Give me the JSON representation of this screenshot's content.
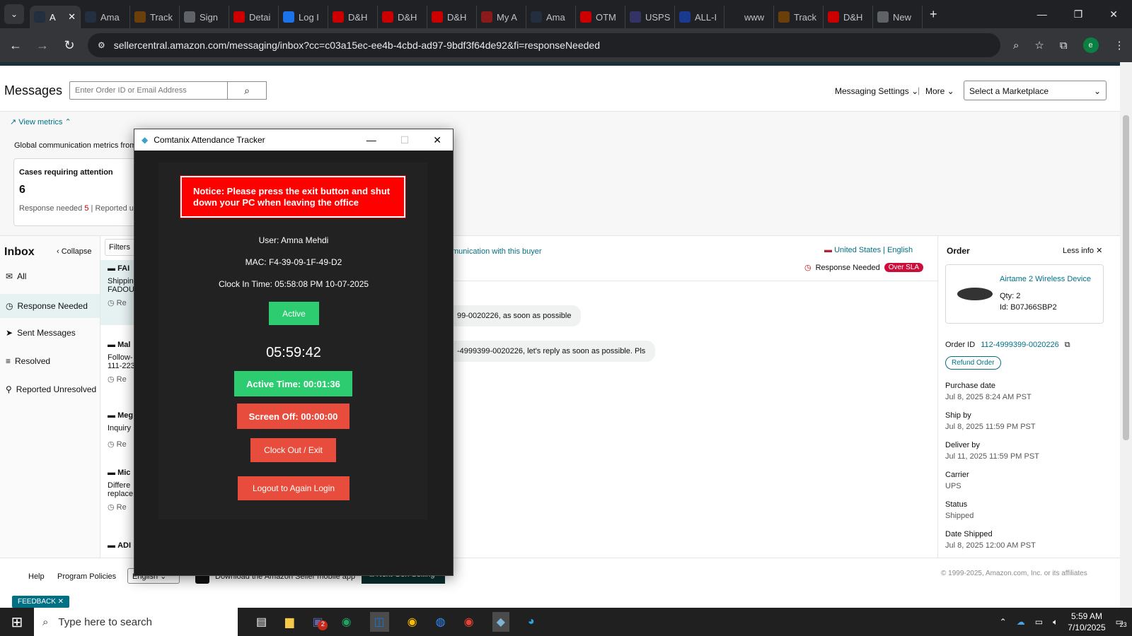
{
  "browser": {
    "tabs": [
      {
        "label": "A",
        "icon": "amazon-icon",
        "color": "#232f3e"
      },
      {
        "label": "Ama",
        "icon": "amazon-icon",
        "color": "#232f3e"
      },
      {
        "label": "Track",
        "icon": "ups-icon",
        "color": "#6b3f0c"
      },
      {
        "label": "Sign",
        "icon": "globe-icon",
        "color": "#5f6368"
      },
      {
        "label": "Detai",
        "icon": "dh-icon",
        "color": "#c00"
      },
      {
        "label": "Log I",
        "icon": "google-icon",
        "color": "#1a73e8"
      },
      {
        "label": "D&H",
        "icon": "dh-icon",
        "color": "#c00"
      },
      {
        "label": "D&H",
        "icon": "dh-icon",
        "color": "#c00"
      },
      {
        "label": "D&H",
        "icon": "dh-icon",
        "color": "#c00"
      },
      {
        "label": "My A",
        "icon": "my-icon",
        "color": "#8b1a1a"
      },
      {
        "label": "Ama",
        "icon": "amazon-icon",
        "color": "#232f3e"
      },
      {
        "label": "OTM",
        "icon": "otm-icon",
        "color": "#c00"
      },
      {
        "label": "USPS",
        "icon": "usps-icon",
        "color": "#333366"
      },
      {
        "label": "ALL-I",
        "icon": "17track-icon",
        "color": "#1a3a8f"
      },
      {
        "label": "www",
        "icon": "dot-icon",
        "color": "#202124"
      },
      {
        "label": "Track",
        "icon": "ups-icon",
        "color": "#6b3f0c"
      },
      {
        "label": "D&H",
        "icon": "dh-icon",
        "color": "#c00"
      },
      {
        "label": "New",
        "icon": "chrome-icon",
        "color": "#5f6368"
      }
    ],
    "url": "sellercentral.amazon.com/messaging/inbox?cc=c03a15ec-ee4b-4cbd-ad97-9bdf3f64de92&fi=responseNeeded",
    "profile_initial": "e"
  },
  "header": {
    "title": "Messages",
    "search_placeholder": "Enter Order ID or Email Address",
    "messaging_settings": "Messaging Settings",
    "more": "More",
    "marketplace_placeholder": "Select a Marketplace"
  },
  "metrics": {
    "view_metrics": "View metrics",
    "global_text": "Global communication metrics from a",
    "cases_title": "Cases requiring attention",
    "cases_count": "6",
    "response_needed_label": "Response needed",
    "response_needed_count": "5",
    "reported_label": "Reported u"
  },
  "inbox": {
    "title": "Inbox",
    "collapse": "Collapse",
    "filters": "Filters",
    "items": [
      {
        "label": "All",
        "icon": "mail-icon"
      },
      {
        "label": "Response Needed",
        "icon": "clock-icon"
      },
      {
        "label": "Sent Messages",
        "icon": "send-icon"
      },
      {
        "label": "Resolved",
        "icon": "resolved-icon"
      },
      {
        "label": "Reported Unresolved",
        "icon": "reported-icon"
      }
    ],
    "list": [
      {
        "name": "FAI",
        "line1": "Shippin",
        "line2": "FADOU",
        "status": "Re"
      },
      {
        "name": "Mal",
        "line1": "Follow-",
        "line2": "111-223",
        "status": "Re"
      },
      {
        "name": "Meg",
        "line1": "Inquiry",
        "line2": "",
        "status": "Re"
      },
      {
        "name": "Mic",
        "line1": "Differe",
        "line2": "replace",
        "status": "Re"
      },
      {
        "name": "ADI",
        "line1": "",
        "line2": "",
        "status": ""
      }
    ]
  },
  "conversation": {
    "link_text": "munication with this buyer",
    "country": "United States",
    "language": "English",
    "response_status": "Response Needed",
    "sla_badge": "Over SLA",
    "bubble1": "99-0020226, as soon as possible",
    "bubble2": "-4999399-0020226, let's reply as soon as possible. Pls"
  },
  "order": {
    "title": "Order",
    "less_info": "Less info",
    "product_name": "Airtame 2 Wireless Device",
    "qty_label": "Qty:",
    "qty": "2",
    "id_label": "Id:",
    "asin": "B07J66SBP2",
    "order_id_label": "Order ID",
    "order_id": "112-4999399-0020226",
    "refund_button": "Refund Order",
    "purchase_date_label": "Purchase date",
    "purchase_date": "Jul 8, 2025 8:24 AM PST",
    "ship_by_label": "Ship by",
    "ship_by": "Jul 8, 2025 11:59 PM PST",
    "deliver_by_label": "Deliver by",
    "deliver_by": "Jul 11, 2025 11:59 PM PST",
    "carrier_label": "Carrier",
    "carrier": "UPS",
    "status_label": "Status",
    "status": "Shipped",
    "date_shipped_label": "Date Shipped",
    "date_shipped": "Jul 8, 2025 12:00 AM PST"
  },
  "footer": {
    "help": "Help",
    "program_policies": "Program Policies",
    "language": "English",
    "download_app": "Download the Amazon Seller mobile app",
    "next_gen": "Next Gen Selling",
    "copyright": "© 1999-2025, Amazon.com, Inc. or its affiliates",
    "feedback": "FEEDBACK"
  },
  "tracker": {
    "window_title": "Comtanix Attendance Tracker",
    "notice": "Notice: Please press the exit button and shut down your PC when leaving the office",
    "user": "User: Amna Mehdi",
    "mac": "MAC: F4-39-09-1F-49-D2",
    "clock_in": "Clock In Time: 05:58:08 PM 10-07-2025",
    "status_button": "Active",
    "clock": "05:59:42",
    "active_time": "Active Time: 00:01:36",
    "screen_off": "Screen Off: 00:00:00",
    "clock_out": "Clock Out / Exit",
    "logout": "Logout to Again Login",
    "colors": {
      "notice": "#ff0000",
      "green": "#2ecc71",
      "red": "#e74c3c"
    }
  },
  "taskbar": {
    "search_placeholder": "Type here to search",
    "time": "5:59 AM",
    "date": "7/10/2025",
    "notification_count": "23",
    "teams_badge": "2"
  }
}
